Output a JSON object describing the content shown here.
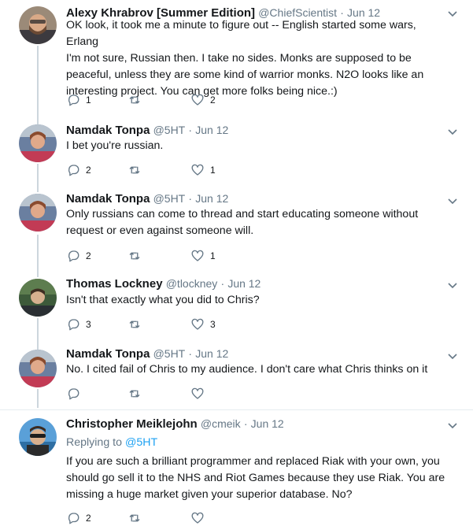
{
  "colors": {
    "icon_gray": "#657786",
    "link_blue": "#1da1f2",
    "thread_line": "#ccd6dd",
    "divider": "#e6ecf0"
  },
  "tweets": [
    {
      "name": "Alexy Khrabrov [Summer Edition]",
      "handle": "@ChiefScientist",
      "time": "Jun 12",
      "lines": [
        "OK look, it took me a minute to figure out -- English started some wars, Erlang",
        "I'm not sure, Russian then. I take no sides. Monks are supposed to be",
        "peaceful, unless they are some kind of warrior monks. N2O looks like an",
        "interesting project.  You can get more folks being nice.:)"
      ],
      "replies": "1",
      "retweets": "",
      "likes": "2"
    },
    {
      "name": "Namdak Tonpa",
      "handle": "@5HT",
      "time": "Jun 12",
      "lines": [
        "I bet you're russian."
      ],
      "replies": "2",
      "retweets": "",
      "likes": "1"
    },
    {
      "name": "Namdak Tonpa",
      "handle": "@5HT",
      "time": "Jun 12",
      "lines": [
        "Only russians can come to thread and start educating someone without",
        "request or even against someone will."
      ],
      "replies": "2",
      "retweets": "",
      "likes": "1"
    },
    {
      "name": "Thomas Lockney",
      "handle": "@tlockney",
      "time": "Jun 12",
      "lines": [
        "Isn't that exactly what you did to Chris?"
      ],
      "replies": "3",
      "retweets": "",
      "likes": "3"
    },
    {
      "name": "Namdak Tonpa",
      "handle": "@5HT",
      "time": "Jun 12",
      "lines": [
        "No. I cited fail of Chris to my audience. I don't care what Chris thinks on it"
      ],
      "replies": "",
      "retweets": "",
      "likes": ""
    },
    {
      "name": "Christopher Meiklejohn",
      "handle": "@cmeik",
      "time": "Jun 12",
      "replying_label": "Replying to",
      "replying_handle": "@5HT",
      "lines": [
        "If you are such a brilliant programmer and replaced Riak with your own, you",
        "should go sell it to the NHS and Riot Games because they use Riak.  You are",
        "missing a huge market given your superior database.  No?"
      ],
      "replies": "2",
      "retweets": "",
      "likes": ""
    }
  ],
  "separator_dot": "·"
}
